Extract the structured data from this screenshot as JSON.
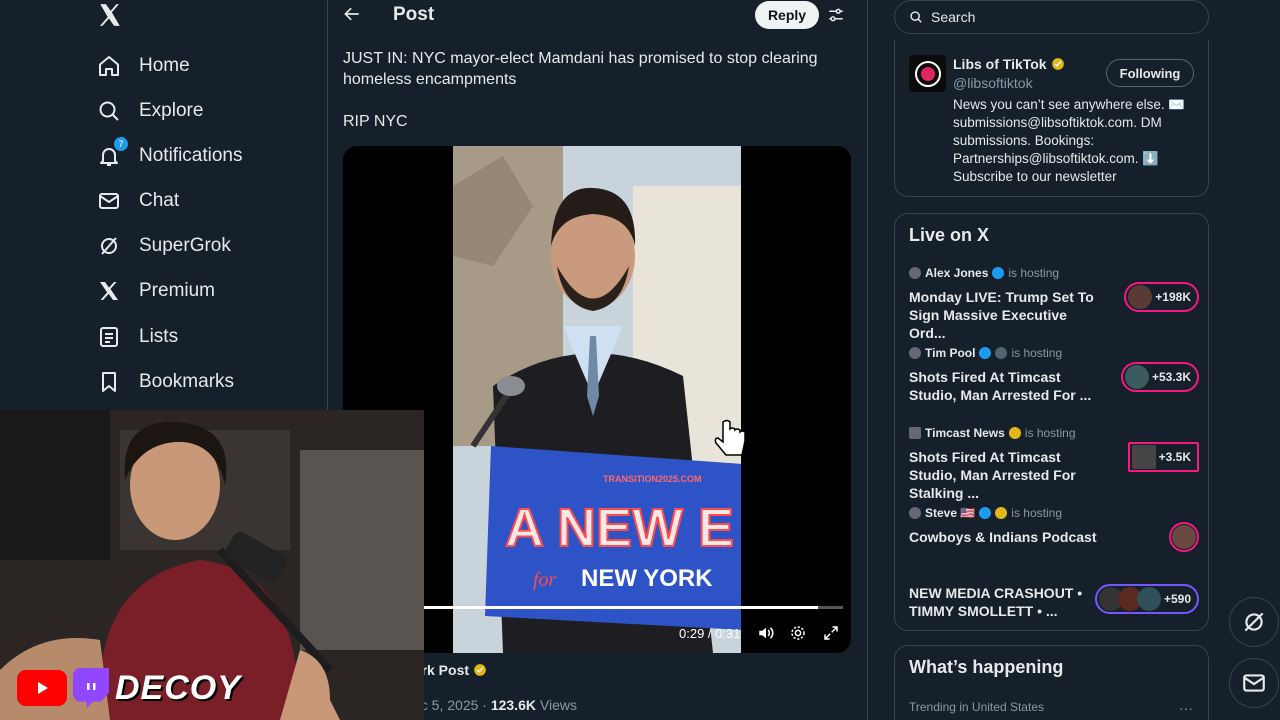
{
  "sidebar": {
    "logo": "X",
    "items": [
      {
        "label": "Home"
      },
      {
        "label": "Explore"
      },
      {
        "label": "Notifications",
        "badge": "7"
      },
      {
        "label": "Chat"
      },
      {
        "label": "SuperGrok"
      },
      {
        "label": "Premium"
      },
      {
        "label": "Lists"
      },
      {
        "label": "Bookmarks"
      }
    ]
  },
  "post": {
    "header_title": "Post",
    "reply_label": "Reply",
    "text": "JUST IN: NYC mayor-elect Mamdani has promised to stop clearing homeless encampments",
    "text2": "RIP NYC",
    "video": {
      "sign_url": "TRANSITION2025.COM",
      "sign_main": "A NEW E",
      "sign_for": "for",
      "sign_city": "NEW YORK",
      "time": "0:29 / 0:31",
      "progress": 0.94
    },
    "author_partial": "ork Post",
    "date_partial": "ec 5, 2025 · ",
    "views_count": "123.6K",
    "views_label": " Views"
  },
  "right": {
    "search_placeholder": "Search",
    "profile": {
      "name": "Libs of TikTok",
      "handle": "@libsoftiktok",
      "following_label": "Following",
      "bio": "News you can’t see anywhere else. ✉️ submissions@libsoftiktok.com. DM submissions. Bookings: Partnerships@libsoftiktok.com. ⬇️ Subscribe to our newsletter"
    },
    "live": {
      "title": "Live on X",
      "items": [
        {
          "host": "Alex Jones",
          "hosting": "is hosting",
          "topic": "Monday LIVE: Trump Set To Sign Massive Executive Ord...",
          "count": "+198K"
        },
        {
          "host": "Tim Pool",
          "hosting": "is hosting",
          "topic": "Shots Fired At Timcast Studio, Man Arrested For ...",
          "count": "+53.3K"
        },
        {
          "host": "Timcast News",
          "hosting": "is hosting",
          "topic": "Shots Fired At Timcast Studio, Man Arrested For Stalking ...",
          "count": "+3.5K"
        },
        {
          "host": "Steve 🇺🇸",
          "hosting": "is hosting",
          "topic": "Cowboys & Indians Podcast",
          "count": ""
        },
        {
          "host": "",
          "hosting": "",
          "topic": "NEW MEDIA CRASHOUT • TIMMY SMOLLETT • ...",
          "count": "+590"
        }
      ]
    },
    "happening": {
      "title": "What’s happening",
      "trend_label": "Trending in United States",
      "more": "···"
    }
  },
  "overlay": {
    "brand": "DECOY"
  },
  "colors": {
    "background": "#15202b",
    "accent": "#1d9bf0",
    "live_ring": "#f91880",
    "verified_gold": "#e2b719"
  }
}
